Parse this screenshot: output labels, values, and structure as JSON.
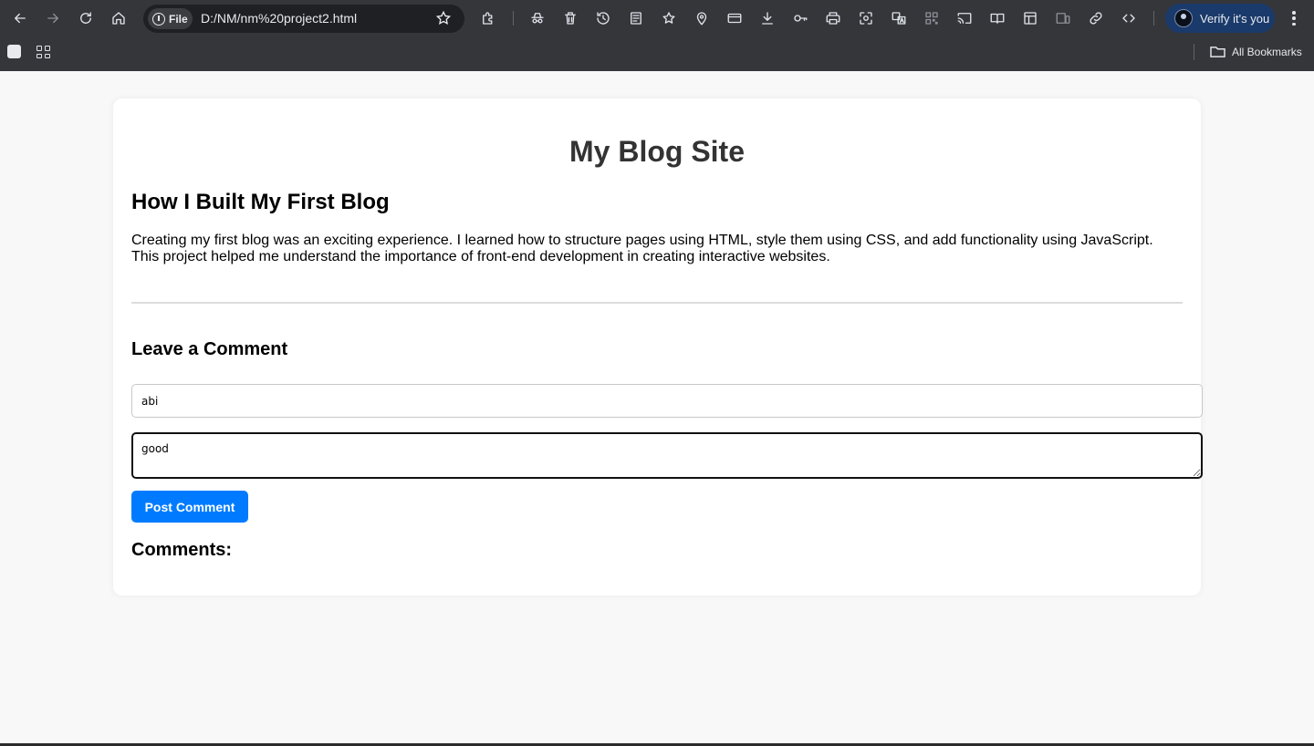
{
  "browser": {
    "chip_label": "File",
    "url": "D:/NM/nm%20project2.html",
    "profile_label": "Verify it's you",
    "bookmarks_label": "All Bookmarks"
  },
  "page": {
    "site_title": "My Blog Site",
    "post": {
      "title": "How I Built My First Blog",
      "body": "Creating my first blog was an exciting experience. I learned how to structure pages using HTML, style them using CSS, and add functionality using JavaScript. This project helped me understand the importance of front-end development in creating interactive websites."
    },
    "comment_form": {
      "heading": "Leave a Comment",
      "name_value": "abi",
      "comment_value": "good",
      "submit_label": "Post Comment"
    },
    "comments_heading": "Comments:"
  },
  "colors": {
    "browser_frame": "#35363a",
    "accent": "#007bff",
    "profile_pill": "#1a3a6b"
  }
}
